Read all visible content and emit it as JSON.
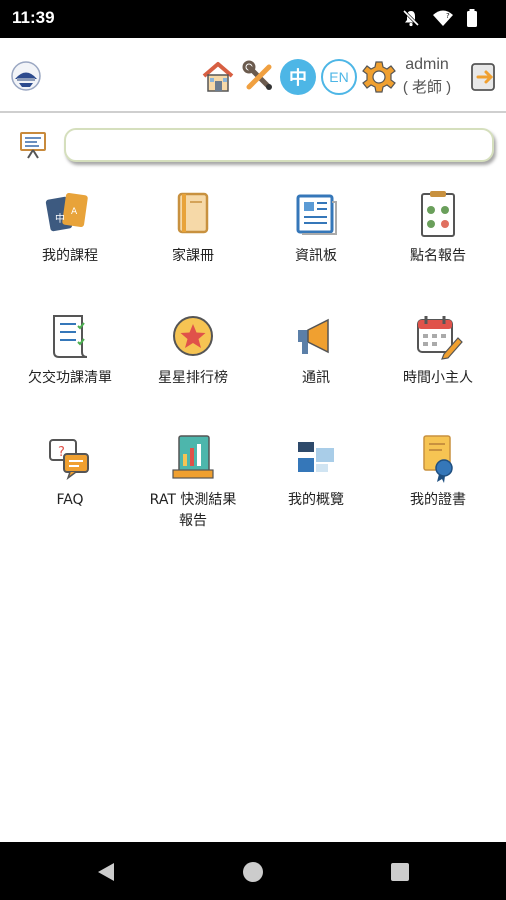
{
  "status_bar": {
    "time": "11:39",
    "icons": [
      "mute-icon",
      "wifi-icon",
      "battery-icon"
    ]
  },
  "header": {
    "logo": "school-logo",
    "toolbar_icons": [
      "home-icon",
      "tools-icon",
      "gear-icon",
      "logout-icon"
    ],
    "lang_zh": "中",
    "lang_en": "EN",
    "user_name": "admin",
    "user_role": "( 老師 )"
  },
  "search": {
    "value": "",
    "placeholder": "",
    "icon": "whiteboard-icon"
  },
  "grid": {
    "items": [
      {
        "label": "我的課程",
        "icon": "courses-icon"
      },
      {
        "label": "家課冊",
        "icon": "homework-book-icon"
      },
      {
        "label": "資訊板",
        "icon": "info-board-icon"
      },
      {
        "label": "點名報告",
        "icon": "attendance-report-icon"
      },
      {
        "label": "欠交功課清單",
        "icon": "missing-homework-icon"
      },
      {
        "label": "星星排行榜",
        "icon": "star-ranking-icon"
      },
      {
        "label": "通訊",
        "icon": "megaphone-icon"
      },
      {
        "label": "時間小主人",
        "icon": "calendar-icon"
      },
      {
        "label": "FAQ",
        "icon": "faq-icon"
      },
      {
        "label": "RAT 快測結果報告",
        "icon": "rat-report-icon"
      },
      {
        "label": "我的概覽",
        "icon": "overview-icon"
      },
      {
        "label": "我的證書",
        "icon": "certificate-icon"
      }
    ]
  },
  "nav_bar": {
    "buttons": [
      "back-icon",
      "home-circle-icon",
      "recents-icon"
    ]
  },
  "colors": {
    "accent": "#4db6e6",
    "status_bar": "#000000"
  }
}
